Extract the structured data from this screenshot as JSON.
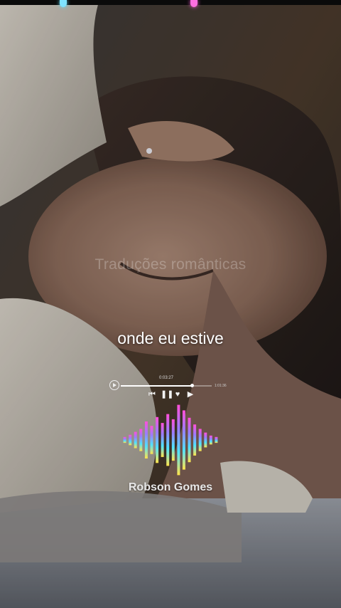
{
  "overlay": {
    "watermark": "Traduções românticas",
    "lyric": "onde eu estive",
    "artist": "Robson Gomes"
  },
  "player": {
    "current_time": "0:03:27",
    "total_time": "1:01:36",
    "progress": 0.78,
    "controls": [
      "previous-icon",
      "pause-icon",
      "heart-icon",
      "next-icon"
    ]
  },
  "visualizer": {
    "levels": [
      0.08,
      0.14,
      0.22,
      0.3,
      0.5,
      0.38,
      0.62,
      0.46,
      0.7,
      0.56,
      0.95,
      0.8,
      0.6,
      0.42,
      0.3,
      0.2,
      0.12,
      0.08
    ],
    "colors": [
      "#ff4fd8",
      "#9b7dff",
      "#4fe3ff",
      "#ffe34a"
    ]
  },
  "colors": {
    "accent_pink": "#ff5ed8",
    "accent_cyan": "#62e6ff"
  }
}
